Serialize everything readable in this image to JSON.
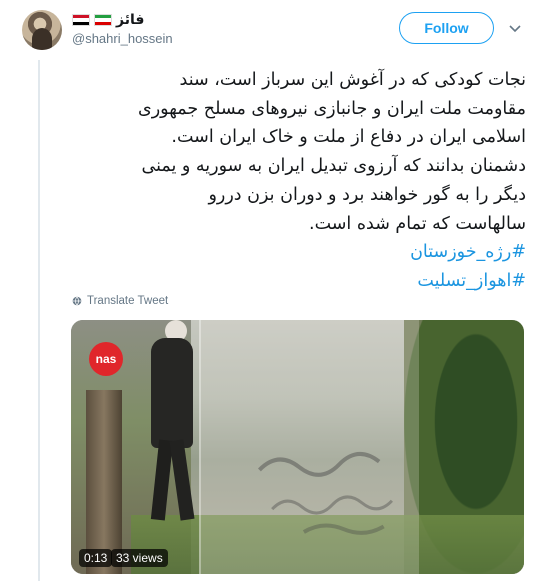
{
  "author": {
    "display_name": "فائز",
    "handle": "@shahri_hossein",
    "flags": [
      "flag-iran-icon",
      "flag-iraq-icon"
    ]
  },
  "actions": {
    "follow_label": "Follow",
    "menu_icon": "chevron-down-icon"
  },
  "tweet": {
    "lines": [
      "نجات کودکی که در آغوش این سرباز است، سند",
      "مقاومت ملت ایران و جانبازی نیروهای مسلح جمهوری",
      "اسلامی ایران در دفاع از ملت و خاک ایران است.",
      "دشمنان بدانند که آرزوی تبدیل ایران به سوریه و یمنی",
      "دیگر را به گور خواهند برد و دوران بزن دررو",
      "سالهاست که تمام شده است."
    ],
    "hashtags": [
      "#رژه_خوزستان",
      "#اهواز_تسلیت"
    ]
  },
  "translate": {
    "label": "Translate Tweet",
    "icon": "globe-icon"
  },
  "media": {
    "overlay_logo": "nas",
    "duration": "0:13",
    "views": "33 views"
  },
  "colors": {
    "accent": "#1da1f2",
    "hashtag": "#1b95e0",
    "muted": "#657786",
    "text": "#14171a"
  }
}
